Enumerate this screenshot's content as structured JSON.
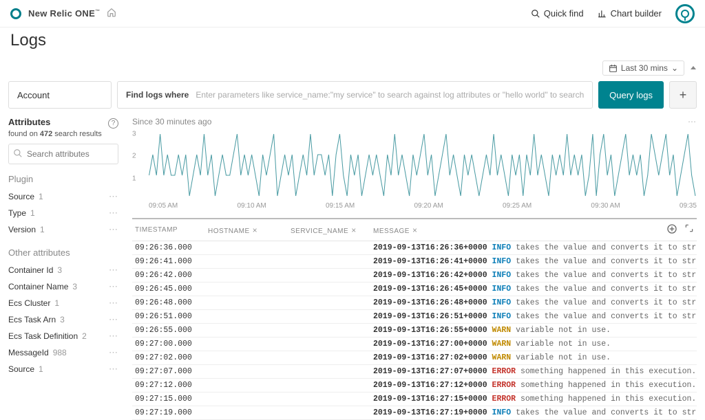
{
  "header": {
    "brand": "New Relic ONE",
    "quick_find": "Quick find",
    "chart_builder": "Chart builder"
  },
  "page": {
    "title": "Logs",
    "time_picker": "Last 30 mins"
  },
  "query": {
    "account_label": "Account",
    "find_label": "Find logs where",
    "placeholder": "Enter parameters like service_name:\"my service\" to search against log attributes or \"hello world\" to search against the message field",
    "button": "Query logs"
  },
  "sidebar": {
    "attributes_title": "Attributes",
    "found_prefix": "found on ",
    "found_count": "472",
    "found_suffix": " search results",
    "search_placeholder": "Search attributes",
    "plugin_title": "Plugin",
    "plugin_items": [
      {
        "name": "Source",
        "count": "1"
      },
      {
        "name": "Type",
        "count": "1"
      },
      {
        "name": "Version",
        "count": "1"
      }
    ],
    "other_title": "Other attributes",
    "other_items": [
      {
        "name": "Container Id",
        "count": "3"
      },
      {
        "name": "Container Name",
        "count": "3"
      },
      {
        "name": "Ecs Cluster",
        "count": "1"
      },
      {
        "name": "Ecs Task Arn",
        "count": "3"
      },
      {
        "name": "Ecs Task Definition",
        "count": "2"
      },
      {
        "name": "MessageId",
        "count": "988"
      },
      {
        "name": "Source",
        "count": "1"
      }
    ]
  },
  "content": {
    "since": "Since 30 minutes ago",
    "columns": {
      "timestamp": "TIMESTAMP",
      "hostname": "HOSTNAME",
      "service": "SERVICE_NAME",
      "message": "MESSAGE"
    },
    "rows": [
      {
        "time": "09:26:36.000",
        "ts": "2019-09-13T16:26:36+0000",
        "lvl": "INFO",
        "txt": "takes the value and converts it to string."
      },
      {
        "time": "09:26:41.000",
        "ts": "2019-09-13T16:26:41+0000",
        "lvl": "INFO",
        "txt": "takes the value and converts it to string."
      },
      {
        "time": "09:26:42.000",
        "ts": "2019-09-13T16:26:42+0000",
        "lvl": "INFO",
        "txt": "takes the value and converts it to string."
      },
      {
        "time": "09:26:45.000",
        "ts": "2019-09-13T16:26:45+0000",
        "lvl": "INFO",
        "txt": "takes the value and converts it to string."
      },
      {
        "time": "09:26:48.000",
        "ts": "2019-09-13T16:26:48+0000",
        "lvl": "INFO",
        "txt": "takes the value and converts it to string."
      },
      {
        "time": "09:26:51.000",
        "ts": "2019-09-13T16:26:51+0000",
        "lvl": "INFO",
        "txt": "takes the value and converts it to string."
      },
      {
        "time": "09:26:55.000",
        "ts": "2019-09-13T16:26:55+0000",
        "lvl": "WARN",
        "txt": "variable not in use."
      },
      {
        "time": "09:27:00.000",
        "ts": "2019-09-13T16:27:00+0000",
        "lvl": "WARN",
        "txt": "variable not in use."
      },
      {
        "time": "09:27:02.000",
        "ts": "2019-09-13T16:27:02+0000",
        "lvl": "WARN",
        "txt": "variable not in use."
      },
      {
        "time": "09:27:07.000",
        "ts": "2019-09-13T16:27:07+0000",
        "lvl": "ERROR",
        "txt": "something happened in this execution."
      },
      {
        "time": "09:27:12.000",
        "ts": "2019-09-13T16:27:12+0000",
        "lvl": "ERROR",
        "txt": "something happened in this execution."
      },
      {
        "time": "09:27:15.000",
        "ts": "2019-09-13T16:27:15+0000",
        "lvl": "ERROR",
        "txt": "something happened in this execution."
      },
      {
        "time": "09:27:19.000",
        "ts": "2019-09-13T16:27:19+0000",
        "lvl": "INFO",
        "txt": "takes the value and converts it to string."
      }
    ]
  },
  "chart_data": {
    "type": "line",
    "title": "",
    "xlabel": "",
    "ylabel": "",
    "ylim": [
      0,
      3
    ],
    "y_ticks": [
      "1",
      "2",
      "3"
    ],
    "x_ticks": [
      "09:05 AM",
      "09:10 AM",
      "09:15 AM",
      "09:20 AM",
      "09:25 AM",
      "09:30 AM",
      "09:35"
    ],
    "x": [
      0,
      1,
      2,
      3,
      4,
      5,
      6,
      7,
      8,
      9,
      10,
      11,
      12,
      13,
      14,
      15,
      16,
      17,
      18,
      19,
      20,
      21,
      22,
      23,
      24,
      25,
      26,
      27,
      28,
      29,
      30,
      31,
      32,
      33,
      34,
      35,
      36,
      37,
      38,
      39,
      40,
      41,
      42,
      43,
      44,
      45,
      46,
      47,
      48,
      49,
      50,
      51,
      52,
      53,
      54,
      55,
      56,
      57,
      58,
      59,
      60,
      61,
      62,
      63,
      64,
      65,
      66,
      67,
      68,
      69,
      70,
      71,
      72,
      73,
      74,
      75,
      76,
      77,
      78,
      79,
      80,
      81,
      82,
      83,
      84,
      85,
      86,
      87,
      88,
      89,
      90,
      91,
      92,
      93,
      94,
      95,
      96,
      97,
      98,
      99,
      100,
      101,
      102,
      103,
      104,
      105,
      106,
      107,
      108,
      109,
      110,
      111,
      112,
      113,
      114,
      115,
      116,
      117,
      118,
      119,
      120,
      121,
      122,
      123,
      124,
      125,
      126,
      127,
      128,
      129,
      130,
      131,
      132,
      133,
      134,
      135,
      136,
      137,
      138,
      139,
      140,
      141,
      142,
      143,
      144,
      145,
      146,
      147,
      148,
      149
    ],
    "values": [
      1,
      2,
      1,
      3,
      1,
      2,
      1,
      1,
      2,
      1,
      2,
      0,
      1,
      2,
      1,
      3,
      1,
      2,
      0,
      1,
      2,
      1,
      1,
      2,
      3,
      1,
      2,
      1,
      2,
      1,
      0,
      2,
      1,
      2,
      3,
      0,
      1,
      2,
      1,
      2,
      0,
      1,
      2,
      1,
      3,
      1,
      2,
      2,
      1,
      2,
      0,
      2,
      3,
      1,
      0,
      2,
      1,
      2,
      0,
      1,
      2,
      1,
      2,
      1,
      0,
      2,
      1,
      3,
      1,
      2,
      1,
      0,
      2,
      1,
      2,
      3,
      1,
      2,
      0,
      1,
      2,
      3,
      1,
      2,
      1,
      0,
      2,
      1,
      2,
      1,
      0,
      1,
      2,
      1,
      3,
      1,
      2,
      1,
      0,
      2,
      1,
      2,
      0,
      2,
      1,
      3,
      1,
      2,
      1,
      0,
      2,
      1,
      2,
      1,
      3,
      1,
      2,
      1,
      2,
      0,
      1,
      3,
      0,
      2,
      3,
      1,
      2,
      0,
      1,
      2,
      3,
      1,
      2,
      1,
      2,
      0,
      1,
      3,
      2,
      1,
      2,
      3,
      1,
      2,
      0,
      1,
      2,
      3,
      1,
      0
    ]
  }
}
